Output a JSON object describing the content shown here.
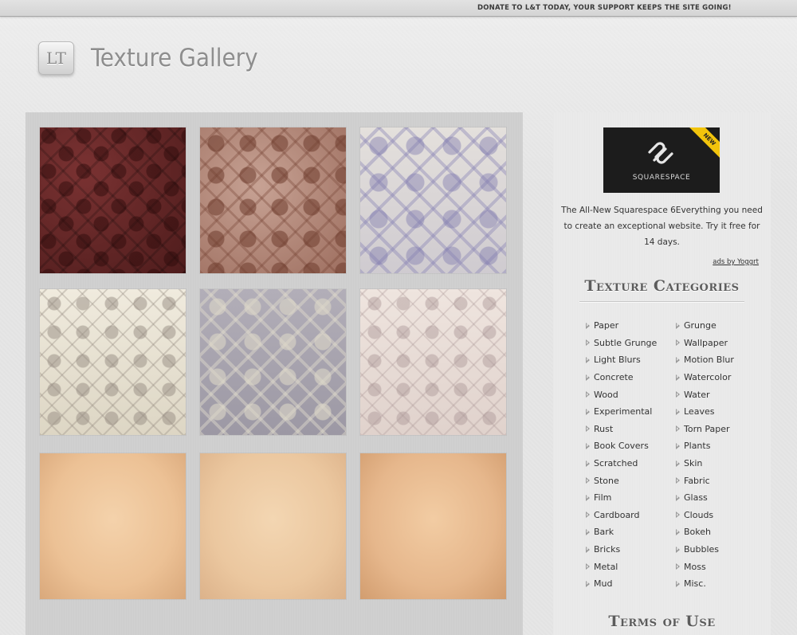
{
  "topbar": {
    "donate_text": "DONATE TO L&T TODAY, YOUR SUPPORT KEEPS THE SITE GOING!"
  },
  "header": {
    "logo_text": "LT",
    "title": "Texture Gallery"
  },
  "gallery": {
    "thumbnails": [
      {
        "pattern": "dark-red-damask"
      },
      {
        "pattern": "rose-brown-damask"
      },
      {
        "pattern": "lavender-damask"
      },
      {
        "pattern": "cream-grey-damask"
      },
      {
        "pattern": "grey-violet-damask"
      },
      {
        "pattern": "pale-pink-damask"
      },
      {
        "pattern": "aged-paper-peach"
      },
      {
        "pattern": "aged-paper-light"
      },
      {
        "pattern": "aged-paper-tan"
      }
    ]
  },
  "sidebar": {
    "ad": {
      "brand": "SQUARESPACE",
      "ribbon": "NEW",
      "text": "The All-New Squarespace 6Everything you need to create an exceptional website. Try it free for 14 days.",
      "ads_by": "ads by Yoggrt"
    },
    "categories_heading": "Texture Categories",
    "categories_left": [
      "Paper",
      "Subtle Grunge",
      "Light Blurs",
      "Concrete",
      "Wood",
      "Experimental",
      "Rust",
      "Book Covers",
      "Scratched",
      "Stone",
      "Film",
      "Cardboard",
      "Bark",
      "Bricks",
      "Metal",
      "Mud"
    ],
    "categories_right": [
      "Grunge",
      "Wallpaper",
      "Motion Blur",
      "Watercolor",
      "Water",
      "Leaves",
      "Torn Paper",
      "Plants",
      "Skin",
      "Fabric",
      "Glass",
      "Clouds",
      "Bokeh",
      "Bubbles",
      "Moss",
      "Misc."
    ],
    "terms_heading": "Terms of Use"
  },
  "colors": {
    "ad_ribbon": "#f2c40c",
    "ad_background": "#1c1c1c",
    "gallery_panel": "#cfcfcf",
    "sidebar_panel": "#eaeaea"
  }
}
